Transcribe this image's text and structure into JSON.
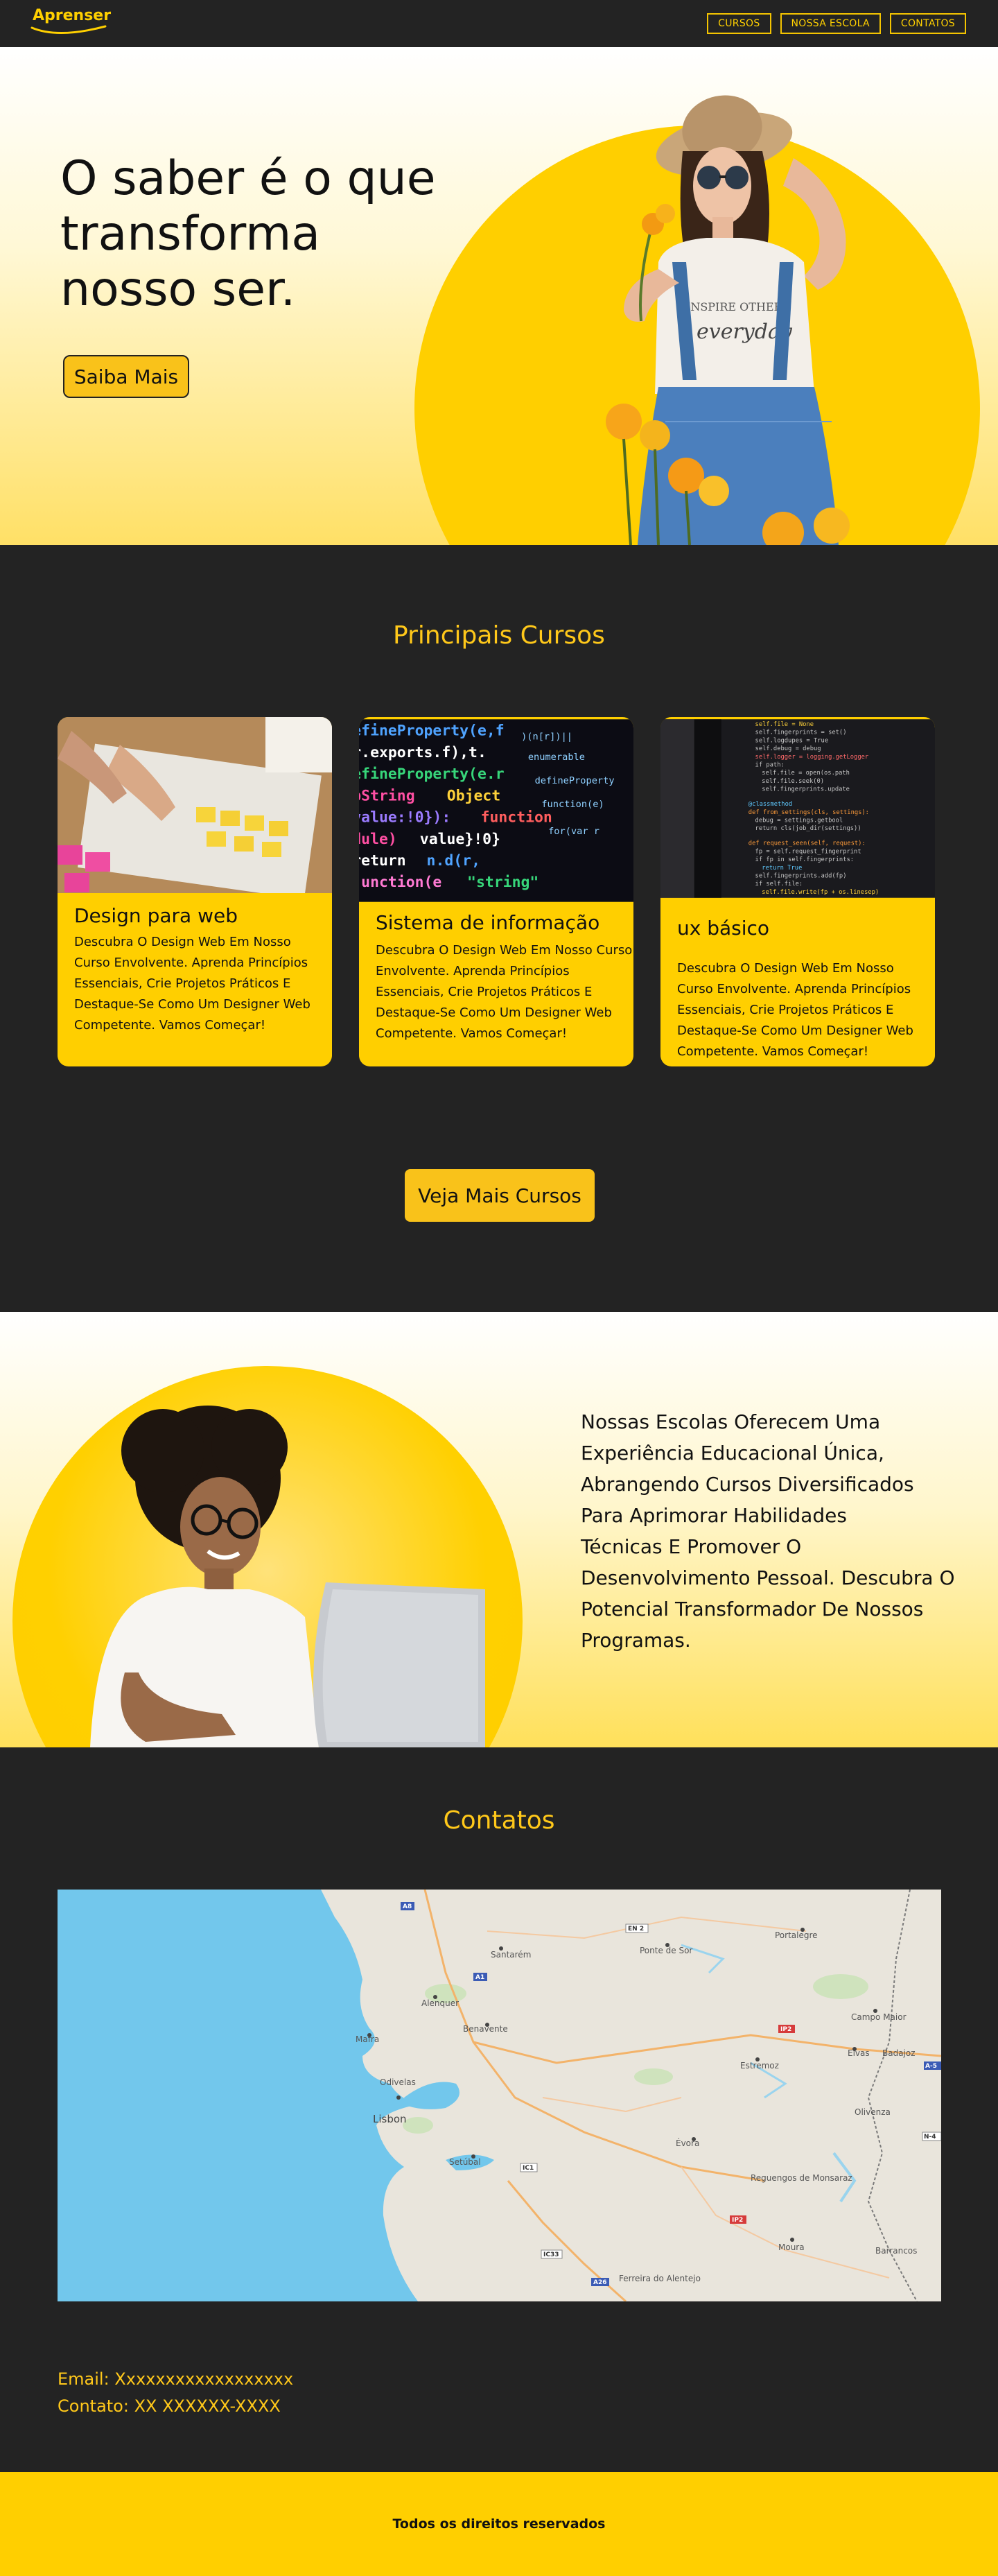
{
  "header": {
    "logo": "Aprenser",
    "nav": [
      "CURSOS",
      "NOSSA ESCOLA",
      "CONTATOS"
    ]
  },
  "hero": {
    "title": "O saber é o que transforma nosso ser.",
    "button": "Saiba Mais",
    "shirt_text_1": "INSPIRE OTHERS",
    "shirt_text_2": "everyday"
  },
  "courses": {
    "title": "Principais Cursos",
    "cards": [
      {
        "title": "Design para web",
        "text": "Descubra O Design Web Em Nosso Curso Envolvente. Aprenda Princípios Essenciais, Crie Projetos Práticos E Destaque-Se Como Um Designer Web Competente. Vamos Começar!"
      },
      {
        "title": "Sistema de informação",
        "text": "Descubra O Design Web Em Nosso Curso Envolvente. Aprenda Princípios Essenciais, Crie Projetos Práticos E Destaque-Se Como Um Designer Web Competente. Vamos Começar!"
      },
      {
        "title": "ux básico",
        "text": "Descubra O Design Web Em Nosso Curso Envolvente. Aprenda Princípios Essenciais, Crie Projetos Práticos E Destaque-Se Como Um Designer Web Competente. Vamos Começar!"
      }
    ],
    "more_button": "Veja Mais Cursos"
  },
  "about": {
    "text": "Nossas Escolas Oferecem Uma Experiência Educacional Única, Abrangendo Cursos Diversificados Para Aprimorar Habilidades\n Técnicas E Promover O Desenvolvimento Pessoal. Descubra O Potencial Transformador De Nossos Programas."
  },
  "contact": {
    "title": "Contatos",
    "email": "Email:  Xxxxxxxxxxxxxxxxxx",
    "phone": "Contato: XX XXXXXX-XXXX",
    "map_labels": [
      "Santarém",
      "Ponte de Sor",
      "Portalegre",
      "Alenquer",
      "Benavente",
      "Campo Maior",
      "Mafra",
      "Estremoz",
      "Elvas",
      "Badajoz",
      "Odivelas",
      "Lisbon",
      "Olivenza",
      "Setúbal",
      "Évora",
      "Reguengos de Monsaraz",
      "Moura",
      "Barrancos",
      "Ferreira do Alentejo"
    ],
    "road_labels": [
      "A8",
      "A1",
      "IC1",
      "IC33",
      "A26",
      "IP2",
      "IP2",
      "EN 2",
      "A-5",
      "N-4"
    ]
  },
  "footer": {
    "text": "Todos os direitos reservados"
  }
}
